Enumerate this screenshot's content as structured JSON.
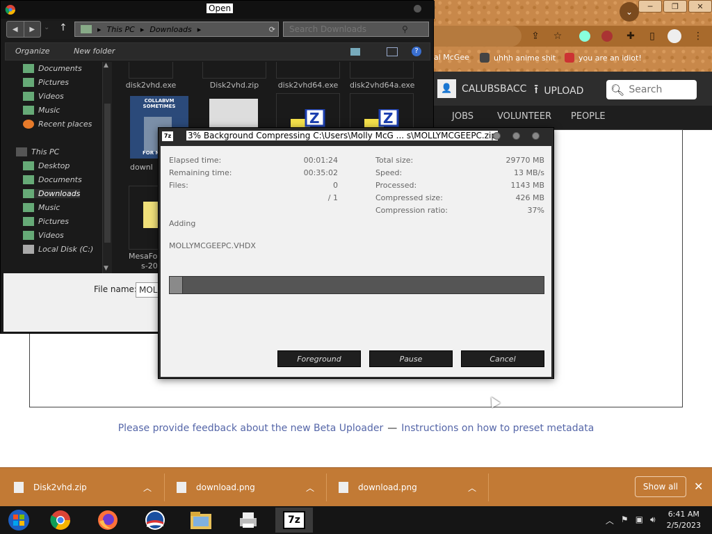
{
  "browser": {
    "bookmarks": [
      {
        "label": "al McGee"
      },
      {
        "label": "uhhh anime shit"
      },
      {
        "label": "you are an idiot!"
      }
    ],
    "nav": {
      "user": "CALUBSBACC",
      "upload": "UPLOAD",
      "search_placeholder": "Search",
      "menu": [
        "JOBS",
        "VOLUNTEER",
        "PEOPLE"
      ]
    },
    "feedback": {
      "link1": "Please provide feedback about the new Beta Uploader",
      "separator": "—",
      "link2": "Instructions on how to preset metadata"
    }
  },
  "downloads": {
    "items": [
      {
        "name": "Disk2vhd.zip",
        "icon": "zip-icon"
      },
      {
        "name": "download.png",
        "icon": "image-icon"
      },
      {
        "name": "download.png",
        "icon": "image-icon"
      }
    ],
    "show_all": "Show all"
  },
  "taskbar": {
    "apps": [
      "start-orb-icon",
      "chrome-icon",
      "firefox-icon",
      "obama-logo-icon",
      "explorer-icon",
      "network-printer-icon",
      "7zip-icon"
    ],
    "time": "6:41 AM",
    "date": "2/5/2023"
  },
  "open_dialog": {
    "title": "Open",
    "breadcrumb": [
      "This PC",
      "Downloads"
    ],
    "search_placeholder": "Search Downloads",
    "toolbar": {
      "organize": "Organize",
      "new_folder": "New folder"
    },
    "nav_items": [
      {
        "label": "Documents",
        "selected": false
      },
      {
        "label": "Pictures",
        "selected": false
      },
      {
        "label": "Videos",
        "selected": false
      },
      {
        "label": "Music",
        "selected": false
      },
      {
        "label": "Recent places",
        "selected": false
      },
      {
        "label": "This PC",
        "selected": false
      },
      {
        "label": "Desktop",
        "selected": false
      },
      {
        "label": "Documents",
        "selected": false
      },
      {
        "label": "Downloads",
        "selected": true
      },
      {
        "label": "Music",
        "selected": false
      },
      {
        "label": "Pictures",
        "selected": false
      },
      {
        "label": "Videos",
        "selected": false
      },
      {
        "label": "Local Disk (C:)",
        "selected": false
      }
    ],
    "files": [
      {
        "label": "disk2vhd.exe"
      },
      {
        "label": "Disk2vhd.zip"
      },
      {
        "label": "disk2vhd64.exe"
      },
      {
        "label": "disk2vhd64a.exe"
      },
      {
        "label": "downl"
      },
      {
        "label": "MesaFo"
      },
      {
        "label": "s-20"
      }
    ],
    "thumb_caption": "COLLABVM SOMETIMES",
    "thumb_caption2": "FOR NO",
    "file_name_label": "File name:",
    "file_name_value": "MOL"
  },
  "zip_dialog": {
    "title": "3% Background Compressing C:\\Users\\Molly McG ... s\\MOLLYMCGEEPC.zip",
    "stats_left": [
      {
        "label": "Elapsed time:",
        "value": "00:01:24"
      },
      {
        "label": "Remaining time:",
        "value": "00:35:02"
      },
      {
        "label": "Files:",
        "value": "0"
      },
      {
        "label": "",
        "value": "/ 1"
      }
    ],
    "stats_right": [
      {
        "label": "Total size:",
        "value": "29770 MB"
      },
      {
        "label": "Speed:",
        "value": "13 MB/s"
      },
      {
        "label": "Processed:",
        "value": "1143 MB"
      },
      {
        "label": "Compressed size:",
        "value": "426 MB"
      },
      {
        "label": "Compression ratio:",
        "value": "37%"
      }
    ],
    "status": "Adding",
    "current_file": "MOLLYMCGEEPC.VHDX",
    "progress": 0.03,
    "buttons": {
      "foreground": "Foreground",
      "pause": "Pause",
      "cancel": "Cancel"
    }
  }
}
